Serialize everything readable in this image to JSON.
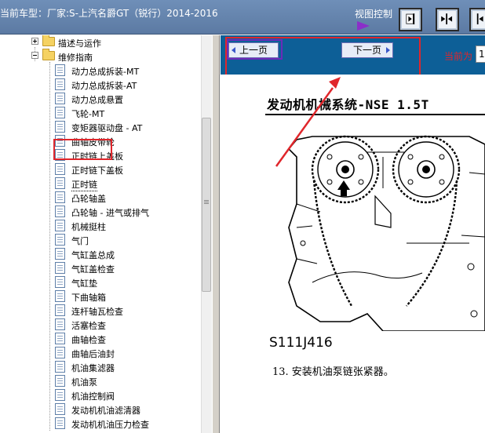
{
  "header": {
    "title": "当前车型：厂家:S-上汽名爵GT（锐行）2014-2016",
    "view_control_label": "视图控制"
  },
  "toolbar": {
    "buttons": [
      {
        "name": "collapse-left-pane",
        "icon": "pane-collapse-icon"
      },
      {
        "name": "split-view",
        "icon": "split-view-icon"
      },
      {
        "name": "expand-right-pane",
        "icon": "pane-expand-icon"
      }
    ]
  },
  "tree": {
    "folders": [
      {
        "label": "描述与运作",
        "state": "collapsed"
      },
      {
        "label": "维修指南",
        "state": "expanded"
      }
    ],
    "items": [
      "动力总成拆装-MT",
      "动力总成拆装-AT",
      "动力总成悬置",
      "飞轮-MT",
      "变矩器驱动盘 - AT",
      "曲轴皮带轮",
      "正时链上盖板",
      "正时链下盖板",
      "正时链",
      "凸轮轴盖",
      "凸轮轴 - 进气或排气",
      "机械挺柱",
      "气门",
      "气缸盖总成",
      "气缸盖检查",
      "气缸垫",
      "下曲轴箱",
      "连杆轴瓦检查",
      "活塞检查",
      "曲轴检查",
      "曲轴后油封",
      "机油集滤器",
      "机油泵",
      "机油控制阀",
      "发动机机油滤清器",
      "发动机机油压力检查"
    ],
    "selected_index": 8
  },
  "navigation": {
    "prev_label": "上一页",
    "next_label": "下一页",
    "page_label": "当前为",
    "page_value": "1"
  },
  "document": {
    "title": "发动机机械系统-NSE 1.5T",
    "figure_code": "S111J416",
    "step_text": "13. 安装机油泵链张紧器。"
  },
  "colors": {
    "header_bg": "#6a88b1",
    "nav_bg": "#0d5f97",
    "annotation_red": "#e0262b",
    "purple_accent": "#8b2fc9"
  }
}
